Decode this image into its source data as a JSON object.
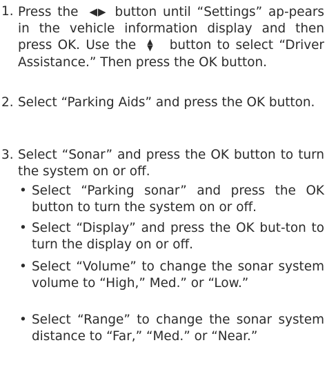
{
  "steps": [
    {
      "number": "1.",
      "t1": "Press the",
      "icon1": "left-right-arrows-icon",
      "t2": "button until “Settings” ap-pears in the vehicle information display and then press OK. Use the",
      "icon2": "up-down-arrows-icon",
      "t3": "button to select “Driver Assistance.” Then press the OK button."
    },
    {
      "number": "2.",
      "text": "Select “Parking Aids” and press the OK button."
    },
    {
      "number": "3.",
      "text": "Select “Sonar” and press the OK button to turn the system on or off."
    }
  ],
  "bullets": [
    {
      "symbol": "•",
      "text": "Select “Parking sonar” and press the OK button to turn the system on or off."
    },
    {
      "symbol": "•",
      "text": "Select “Display” and press the OK but-ton to turn the display on or off."
    },
    {
      "symbol": "•",
      "text": "Select “Volume” to change the sonar system volume to “High,” Med.” or “Low.”"
    },
    {
      "symbol": "•",
      "text": "Select “Range” to change the sonar system distance to “Far,” “Med.” or “Near.”"
    }
  ]
}
